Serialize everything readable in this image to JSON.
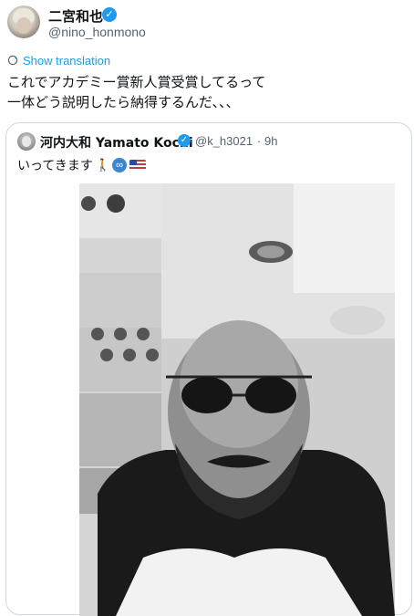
{
  "post": {
    "display_name": "二宮和也",
    "handle": "@nino_honmono",
    "translate_label": "Show translation",
    "text": "これでアカデミー賞新人賞受賞してるって\n一体どう説明したら納得するんだ、、、"
  },
  "quote": {
    "display_name": "河内大和 Yamato Kochi",
    "handle": "@k_h3021",
    "separator": "·",
    "time": "9h",
    "text": "いってきます",
    "emoji_walk": "🚶",
    "badge_symbol": "∞",
    "photo_alt": "Black-and-white selfie of a bald man with sunglasses and beard in an airplane seat"
  },
  "colors": {
    "accent": "#1d9bf0",
    "text_primary": "#0f1419",
    "text_secondary": "#536471",
    "border": "#cfd9de"
  },
  "icons": {
    "verified": "verified-badge-icon",
    "translate": "translate-icon",
    "flag": "us-flag-icon",
    "infinity": "infinity-badge-icon"
  }
}
